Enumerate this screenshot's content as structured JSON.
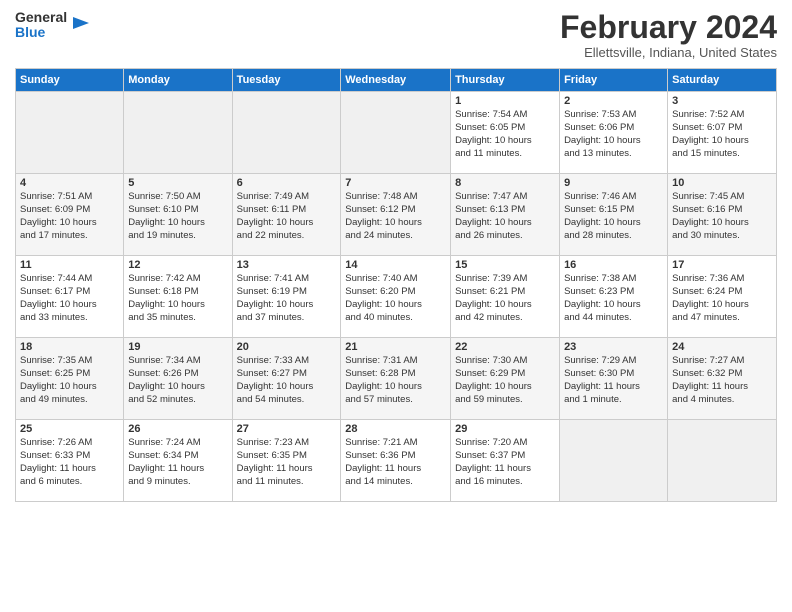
{
  "header": {
    "logo_line1": "General",
    "logo_line2": "Blue",
    "month": "February 2024",
    "location": "Ellettsville, Indiana, United States"
  },
  "days_of_week": [
    "Sunday",
    "Monday",
    "Tuesday",
    "Wednesday",
    "Thursday",
    "Friday",
    "Saturday"
  ],
  "weeks": [
    [
      {
        "day": "",
        "info": ""
      },
      {
        "day": "",
        "info": ""
      },
      {
        "day": "",
        "info": ""
      },
      {
        "day": "",
        "info": ""
      },
      {
        "day": "1",
        "info": "Sunrise: 7:54 AM\nSunset: 6:05 PM\nDaylight: 10 hours\nand 11 minutes."
      },
      {
        "day": "2",
        "info": "Sunrise: 7:53 AM\nSunset: 6:06 PM\nDaylight: 10 hours\nand 13 minutes."
      },
      {
        "day": "3",
        "info": "Sunrise: 7:52 AM\nSunset: 6:07 PM\nDaylight: 10 hours\nand 15 minutes."
      }
    ],
    [
      {
        "day": "4",
        "info": "Sunrise: 7:51 AM\nSunset: 6:09 PM\nDaylight: 10 hours\nand 17 minutes."
      },
      {
        "day": "5",
        "info": "Sunrise: 7:50 AM\nSunset: 6:10 PM\nDaylight: 10 hours\nand 19 minutes."
      },
      {
        "day": "6",
        "info": "Sunrise: 7:49 AM\nSunset: 6:11 PM\nDaylight: 10 hours\nand 22 minutes."
      },
      {
        "day": "7",
        "info": "Sunrise: 7:48 AM\nSunset: 6:12 PM\nDaylight: 10 hours\nand 24 minutes."
      },
      {
        "day": "8",
        "info": "Sunrise: 7:47 AM\nSunset: 6:13 PM\nDaylight: 10 hours\nand 26 minutes."
      },
      {
        "day": "9",
        "info": "Sunrise: 7:46 AM\nSunset: 6:15 PM\nDaylight: 10 hours\nand 28 minutes."
      },
      {
        "day": "10",
        "info": "Sunrise: 7:45 AM\nSunset: 6:16 PM\nDaylight: 10 hours\nand 30 minutes."
      }
    ],
    [
      {
        "day": "11",
        "info": "Sunrise: 7:44 AM\nSunset: 6:17 PM\nDaylight: 10 hours\nand 33 minutes."
      },
      {
        "day": "12",
        "info": "Sunrise: 7:42 AM\nSunset: 6:18 PM\nDaylight: 10 hours\nand 35 minutes."
      },
      {
        "day": "13",
        "info": "Sunrise: 7:41 AM\nSunset: 6:19 PM\nDaylight: 10 hours\nand 37 minutes."
      },
      {
        "day": "14",
        "info": "Sunrise: 7:40 AM\nSunset: 6:20 PM\nDaylight: 10 hours\nand 40 minutes."
      },
      {
        "day": "15",
        "info": "Sunrise: 7:39 AM\nSunset: 6:21 PM\nDaylight: 10 hours\nand 42 minutes."
      },
      {
        "day": "16",
        "info": "Sunrise: 7:38 AM\nSunset: 6:23 PM\nDaylight: 10 hours\nand 44 minutes."
      },
      {
        "day": "17",
        "info": "Sunrise: 7:36 AM\nSunset: 6:24 PM\nDaylight: 10 hours\nand 47 minutes."
      }
    ],
    [
      {
        "day": "18",
        "info": "Sunrise: 7:35 AM\nSunset: 6:25 PM\nDaylight: 10 hours\nand 49 minutes."
      },
      {
        "day": "19",
        "info": "Sunrise: 7:34 AM\nSunset: 6:26 PM\nDaylight: 10 hours\nand 52 minutes."
      },
      {
        "day": "20",
        "info": "Sunrise: 7:33 AM\nSunset: 6:27 PM\nDaylight: 10 hours\nand 54 minutes."
      },
      {
        "day": "21",
        "info": "Sunrise: 7:31 AM\nSunset: 6:28 PM\nDaylight: 10 hours\nand 57 minutes."
      },
      {
        "day": "22",
        "info": "Sunrise: 7:30 AM\nSunset: 6:29 PM\nDaylight: 10 hours\nand 59 minutes."
      },
      {
        "day": "23",
        "info": "Sunrise: 7:29 AM\nSunset: 6:30 PM\nDaylight: 11 hours\nand 1 minute."
      },
      {
        "day": "24",
        "info": "Sunrise: 7:27 AM\nSunset: 6:32 PM\nDaylight: 11 hours\nand 4 minutes."
      }
    ],
    [
      {
        "day": "25",
        "info": "Sunrise: 7:26 AM\nSunset: 6:33 PM\nDaylight: 11 hours\nand 6 minutes."
      },
      {
        "day": "26",
        "info": "Sunrise: 7:24 AM\nSunset: 6:34 PM\nDaylight: 11 hours\nand 9 minutes."
      },
      {
        "day": "27",
        "info": "Sunrise: 7:23 AM\nSunset: 6:35 PM\nDaylight: 11 hours\nand 11 minutes."
      },
      {
        "day": "28",
        "info": "Sunrise: 7:21 AM\nSunset: 6:36 PM\nDaylight: 11 hours\nand 14 minutes."
      },
      {
        "day": "29",
        "info": "Sunrise: 7:20 AM\nSunset: 6:37 PM\nDaylight: 11 hours\nand 16 minutes."
      },
      {
        "day": "",
        "info": ""
      },
      {
        "day": "",
        "info": ""
      }
    ]
  ]
}
